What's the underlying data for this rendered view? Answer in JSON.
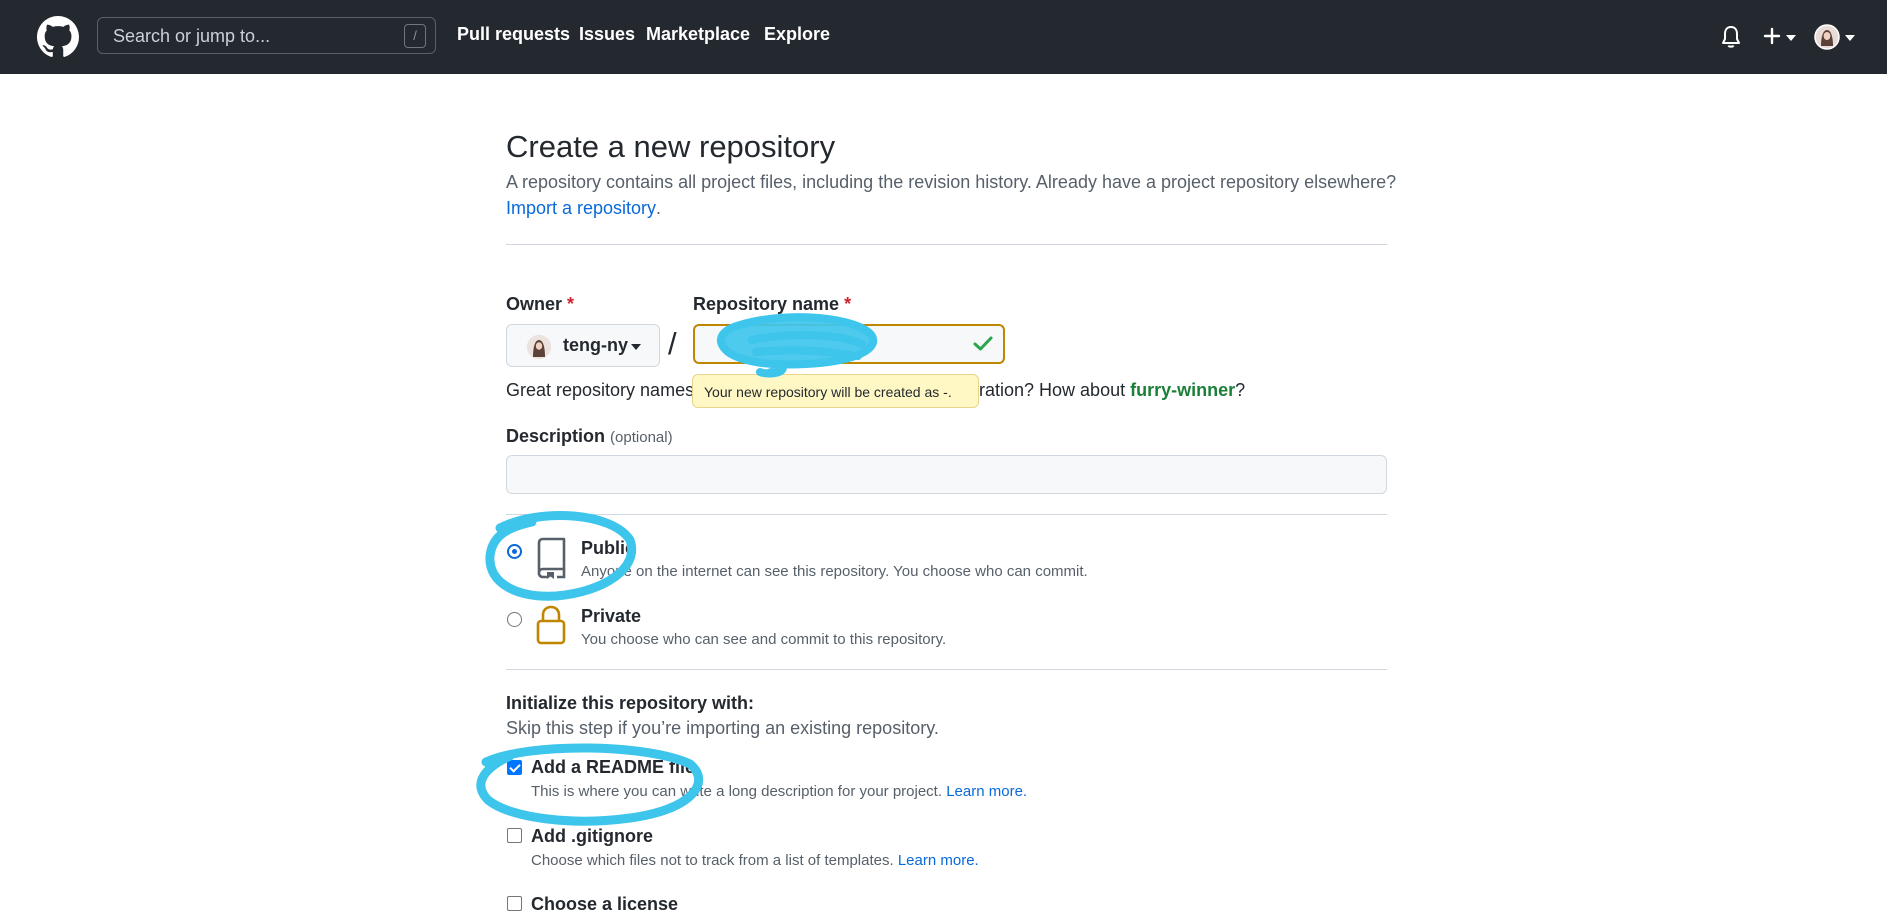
{
  "header": {
    "search_placeholder": "Search or jump to...",
    "search_shortcut": "/",
    "nav": [
      "Pull requests",
      "Issues",
      "Marketplace",
      "Explore"
    ]
  },
  "page": {
    "title": "Create a new repository",
    "subtitle": "A repository contains all project files, including the revision history. Already have a project repository elsewhere?",
    "import_link": "Import a repository",
    "import_suffix": "."
  },
  "form": {
    "owner_label": "Owner",
    "required_mark": "*",
    "owner_value": "teng-ny",
    "separator": "/",
    "repo_name_label": "Repository name",
    "repo_name_value": "",
    "hint_prefix": "Great repository names",
    "hint_middle": "ration? How about",
    "hint_suggestion": "furry-winner",
    "hint_suffix": "?",
    "tooltip": "Your new repository will be created as -.",
    "description_label": "Description",
    "description_optional": "(optional)",
    "description_value": ""
  },
  "visibility": {
    "public_title": "Public",
    "public_desc": "Anyone on the internet can see this repository. You choose who can commit.",
    "private_title": "Private",
    "private_desc": "You choose who can see and commit to this repository.",
    "selected": "public"
  },
  "initialize": {
    "title": "Initialize this repository with:",
    "subtitle": "Skip this step if you’re importing an existing repository.",
    "readme_title": "Add a README file",
    "readme_desc": "This is where you can write a long description for your project.",
    "readme_checked": true,
    "gitignore_title": "Add .gitignore",
    "gitignore_desc": "Choose which files not to track from a list of templates.",
    "gitignore_checked": false,
    "license_title": "Choose a license",
    "license_checked": false,
    "learn_more": "Learn more."
  },
  "colors": {
    "header_bg": "#24292f",
    "link": "#0969da",
    "suggestion_green": "#1a7f37",
    "annotation": "#3ec5ec"
  }
}
